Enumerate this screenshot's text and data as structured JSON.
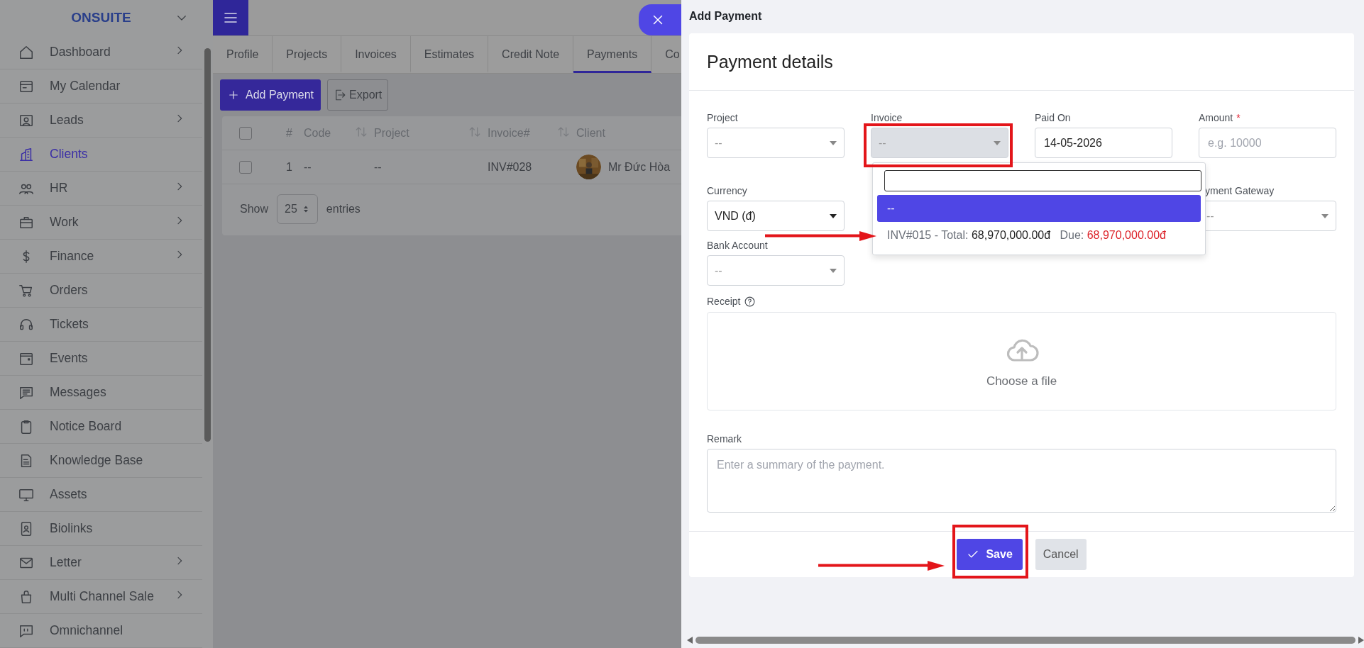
{
  "sidebar": {
    "brand": "ONSUITE",
    "items": [
      {
        "label": "Dashboard",
        "selected": false,
        "has_submenu": true
      },
      {
        "label": "My Calendar",
        "selected": false,
        "has_submenu": false
      },
      {
        "label": "Leads",
        "selected": false,
        "has_submenu": true
      },
      {
        "label": "Clients",
        "selected": true,
        "has_submenu": false
      },
      {
        "label": "HR",
        "selected": false,
        "has_submenu": true
      },
      {
        "label": "Work",
        "selected": false,
        "has_submenu": true
      },
      {
        "label": "Finance",
        "selected": false,
        "has_submenu": true
      },
      {
        "label": "Orders",
        "selected": false,
        "has_submenu": false
      },
      {
        "label": "Tickets",
        "selected": false,
        "has_submenu": false
      },
      {
        "label": "Events",
        "selected": false,
        "has_submenu": false
      },
      {
        "label": "Messages",
        "selected": false,
        "has_submenu": false
      },
      {
        "label": "Notice Board",
        "selected": false,
        "has_submenu": false
      },
      {
        "label": "Knowledge Base",
        "selected": false,
        "has_submenu": false
      },
      {
        "label": "Assets",
        "selected": false,
        "has_submenu": false
      },
      {
        "label": "Biolinks",
        "selected": false,
        "has_submenu": false
      },
      {
        "label": "Letter",
        "selected": false,
        "has_submenu": true
      },
      {
        "label": "Multi Channel Sale",
        "selected": false,
        "has_submenu": true
      },
      {
        "label": "Omnichannel",
        "selected": false,
        "has_submenu": false
      }
    ]
  },
  "tabs": [
    {
      "label": "Profile",
      "selected": false
    },
    {
      "label": "Projects",
      "selected": false
    },
    {
      "label": "Invoices",
      "selected": false
    },
    {
      "label": "Estimates",
      "selected": false
    },
    {
      "label": "Credit Note",
      "selected": false
    },
    {
      "label": "Payments",
      "selected": true
    },
    {
      "label": "Co",
      "selected": false
    }
  ],
  "toolbar": {
    "add_button": "Add Payment",
    "export_button": "Export"
  },
  "table": {
    "select_all_checked": false,
    "columns": [
      "#",
      "Code",
      "Project",
      "Invoice#",
      "Client"
    ],
    "rows": [
      {
        "checked": false,
        "number": "1",
        "code": "--",
        "project": "--",
        "invoice": "INV#028",
        "client": "Mr Đức Hòa"
      }
    ],
    "show_label": "Show",
    "page_size": "25",
    "entries_label": "entries"
  },
  "panel": {
    "title": "Add Payment",
    "card_title": "Payment details",
    "fields": [
      {
        "label": "Project",
        "kind": "select",
        "placeholder": "--",
        "disabled": false
      },
      {
        "label": "Invoice",
        "kind": "select",
        "placeholder": "--",
        "disabled": true
      },
      {
        "label": "Paid On",
        "kind": "input",
        "value": "14-05-2026"
      },
      {
        "label": "Amount",
        "kind": "input",
        "placeholder": "e.g. 10000",
        "required_mark": "*"
      },
      {
        "label": "Currency",
        "kind": "select",
        "value": "VND (đ)",
        "disabled": false
      },
      {
        "label": "yment Gateway",
        "kind": "select",
        "placeholder": "--",
        "disabled": false
      },
      {
        "label": "Bank Account",
        "kind": "select",
        "placeholder": "--",
        "disabled": false
      }
    ],
    "dropdown": {
      "options": [
        {
          "kind": "plain",
          "label": "--",
          "selected": true
        },
        {
          "kind": "invoice",
          "label": "INV#015 - Total:",
          "total": "68,970,000.00đ",
          "due_label": "Due:",
          "due": "68,970,000.00đ",
          "selected": false
        }
      ]
    },
    "receipt": {
      "label": "Receipt",
      "upload_text": "Choose a file"
    },
    "remark": {
      "label": "Remark",
      "placeholder": "Enter a summary of the payment."
    },
    "save_button": "Save",
    "cancel_button": "Cancel"
  }
}
